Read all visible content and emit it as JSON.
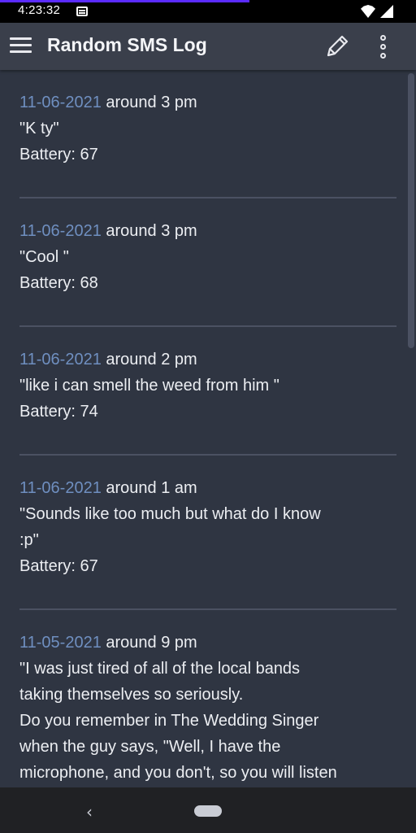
{
  "status": {
    "time": "4:23:32"
  },
  "app_bar": {
    "title": "Random SMS Log"
  },
  "entries": [
    {
      "date": "11-06-2021",
      "time": "around 3 pm",
      "message": "\"K ty\"",
      "battery": "Battery: 67"
    },
    {
      "date": "11-06-2021",
      "time": "around 3 pm",
      "message": "\"Cool \"",
      "battery": "Battery: 68"
    },
    {
      "date": "11-06-2021",
      "time": "around 2 pm",
      "message": "\"like i can smell the weed from him \"",
      "battery": "Battery: 74"
    },
    {
      "date": "11-06-2021",
      "time": "around 1 am",
      "message_lines": [
        "\"Sounds like too much but what do I know",
        ":p\""
      ],
      "battery": "Battery: 67"
    },
    {
      "date": "11-05-2021",
      "time": "around 9 pm",
      "message_lines": [
        "\"I was just tired of all of the local bands",
        "taking themselves so seriously.",
        "Do you remember in The Wedding Singer",
        "when the guy says, \"Well, I have the",
        "microphone, and you don't, so you will listen"
      ]
    }
  ],
  "nav": {
    "back_symbol": "‹"
  },
  "colors": {
    "background": "#2f3542",
    "app_bar": "#3a3f4b",
    "date_accent": "#6f8fc0",
    "divider": "#4b5162"
  }
}
